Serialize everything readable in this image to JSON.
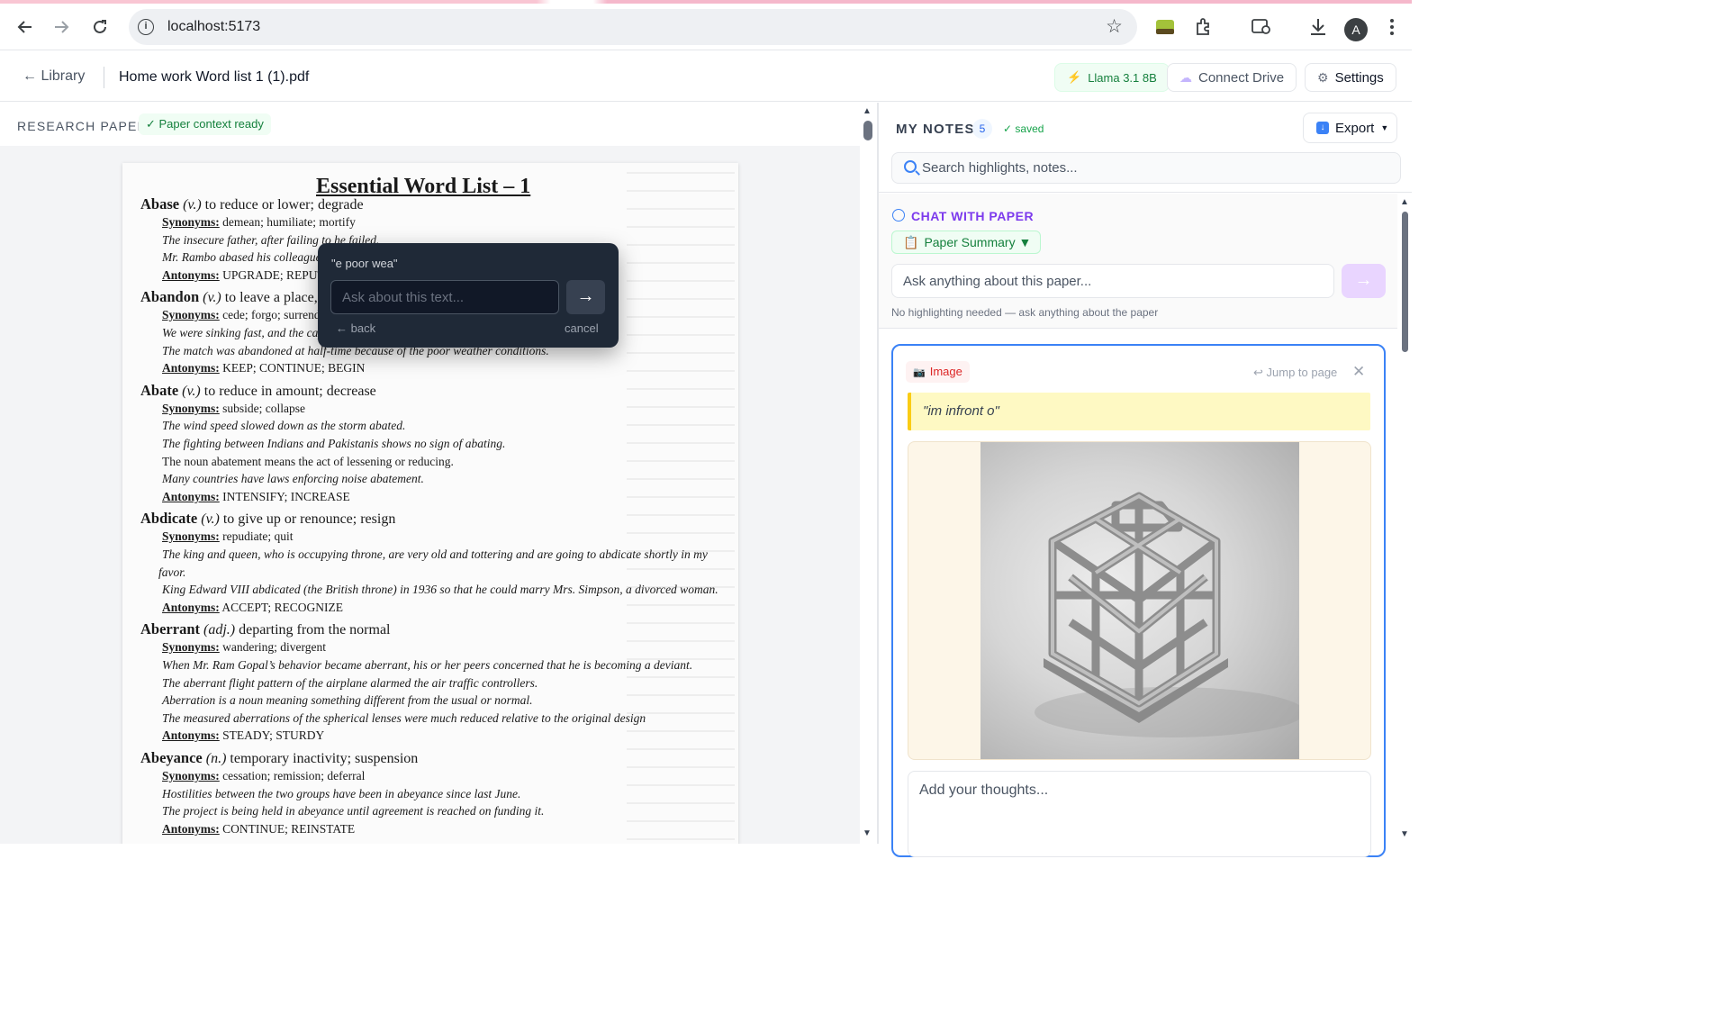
{
  "browser": {
    "url": "localhost:5173"
  },
  "header": {
    "back_label": "← Library",
    "doc_title": "Home work Word list 1 (1).pdf",
    "model": "Llama 3.1 8B",
    "connect_drive": "Connect Drive",
    "settings": "Settings"
  },
  "reader": {
    "label": "RESEARCH PAPER",
    "status": "✓ Paper context ready",
    "page_title": "Essential Word List – 1",
    "lines": [
      {
        "t": "head",
        "word": "Abase",
        "pos": "(v.)",
        "rest": " to reduce or lower; degrade"
      },
      {
        "t": "syn",
        "lbl": "Synonyms:",
        "rest": " demean; humiliate; mortify"
      },
      {
        "t": "ex",
        "text": "The insecure father, after failing to                                                                  he failed."
      },
      {
        "t": "ex",
        "text": "Mr. Rambo abased his colleague"
      },
      {
        "t": "syn",
        "lbl": "Antonyms:",
        "rest": " UPGRADE; REPUTE"
      },
      {
        "t": "head",
        "word": "Abandon",
        "pos": "(v.)",
        "rest": " to leave a place, thing"
      },
      {
        "t": "syn",
        "lbl": "Synonyms:",
        "rest": " cede; forgo; surrender"
      },
      {
        "t": "ex",
        "text": "We were sinking fast, and the cap"
      },
      {
        "t": "ex",
        "text": "The match was abandoned at half-time because of the poor weather conditions."
      },
      {
        "t": "syn",
        "lbl": "Antonyms:",
        "rest": " KEEP; CONTINUE; BEGIN"
      },
      {
        "t": "head",
        "word": "Abate",
        "pos": "(v.)",
        "rest": " to reduce in amount; decrease"
      },
      {
        "t": "syn",
        "lbl": "Synonyms:",
        "rest": " subside; collapse"
      },
      {
        "t": "ex",
        "text": "The wind speed slowed down as the storm abated."
      },
      {
        "t": "ex",
        "text": "The fighting between Indians and Pakistanis shows no sign of abating."
      },
      {
        "t": "plain",
        "text": "The noun abatement means the act of lessening or reducing."
      },
      {
        "t": "ex",
        "text": "Many countries have laws enforcing noise abatement."
      },
      {
        "t": "syn",
        "lbl": "Antonyms:",
        "rest": " INTENSIFY; INCREASE"
      },
      {
        "t": "head",
        "word": "Abdicate",
        "pos": "(v.)",
        "rest": " to give up or renounce; resign"
      },
      {
        "t": "syn",
        "lbl": "Synonyms:",
        "rest": " repudiate; quit"
      },
      {
        "t": "ex",
        "text": "The king and queen, who is occupying throne, are very old and tottering and are going to abdicate shortly in my"
      },
      {
        "t": "ex",
        "text": "favor."
      },
      {
        "t": "ex",
        "text": "King Edward VIII abdicated (the British throne) in 1936 so that he could marry Mrs. Simpson, a divorced woman."
      },
      {
        "t": "syn",
        "lbl": "Antonyms:",
        "rest": " ACCEPT; RECOGNIZE"
      },
      {
        "t": "head",
        "word": "Aberrant",
        "pos": "(adj.)",
        "rest": " departing from the normal"
      },
      {
        "t": "syn",
        "lbl": "Synonyms:",
        "rest": " wandering; divergent"
      },
      {
        "t": "ex",
        "text": "When Mr. Ram Gopal’s behavior became aberrant, his or her peers concerned that he is becoming a deviant."
      },
      {
        "t": "ex",
        "text": "The aberrant flight pattern of the airplane alarmed the air traffic controllers."
      },
      {
        "t": "ex",
        "text": "Aberration is a noun meaning something different from the usual or normal."
      },
      {
        "t": "ex",
        "text": "The measured aberrations of the spherical lenses were much reduced relative to the original design"
      },
      {
        "t": "syn",
        "lbl": "Antonyms:",
        "rest": " STEADY; STURDY"
      },
      {
        "t": "head",
        "word": "Abeyance",
        "pos": "(n.)",
        "rest": " temporary inactivity; suspension"
      },
      {
        "t": "syn",
        "lbl": "Synonyms:",
        "rest": " cessation; remission; deferral"
      },
      {
        "t": "ex",
        "text": "Hostilities between the two groups have been in abeyance since last June."
      },
      {
        "t": "ex",
        "text": "The project is being held in abeyance until agreement is reached on funding it."
      },
      {
        "t": "syn",
        "lbl": "Antonyms:",
        "rest": " CONTINUE; REINSTATE"
      }
    ]
  },
  "popup": {
    "quote": "\"e poor wea\"",
    "placeholder": "Ask about this text...",
    "go": "→",
    "back": "← back",
    "cancel": "cancel"
  },
  "notes": {
    "label": "MY NOTES",
    "count": "5",
    "saved": "✓ saved",
    "export": "Export",
    "search_placeholder": "Search highlights, notes...",
    "chat_title": "CHAT WITH PAPER",
    "summary_btn": "Paper Summary ▼",
    "chat_placeholder": "Ask anything about this paper...",
    "send": "→",
    "hint": "No highlighting needed — ask anything about the paper",
    "card": {
      "tag": "Image",
      "jump": "↩ Jump to page",
      "close": "✕",
      "quote": "\"im infront o\"",
      "thoughts_placeholder": "Add your thoughts..."
    }
  },
  "colors": {
    "accent_blue": "#3b82f6",
    "chat_purple": "#7c3aed",
    "ready_green": "#15803d",
    "highlight_yellow": "#fef9c3"
  }
}
